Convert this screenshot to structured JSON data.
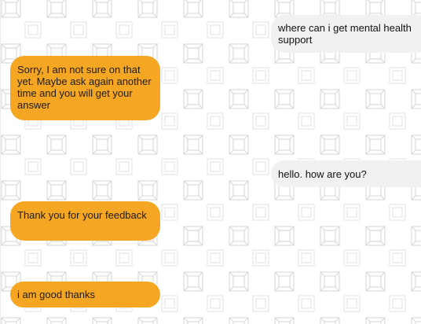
{
  "messages": [
    {
      "sender": "user",
      "text": "where can i get mental health support"
    },
    {
      "sender": "bot",
      "text": "Sorry, I am not sure on that yet. Maybe ask again another time and you will get your answer"
    },
    {
      "sender": "user",
      "text": "hello. how are you?"
    },
    {
      "sender": "bot",
      "text": "Thank you for your feedback"
    },
    {
      "sender": "bot",
      "text": "i am good thanks"
    }
  ],
  "colors": {
    "bot_bubble": "#f5a623",
    "user_bubble": "#f1f1f1",
    "background_pattern": "#d6d6d6"
  }
}
